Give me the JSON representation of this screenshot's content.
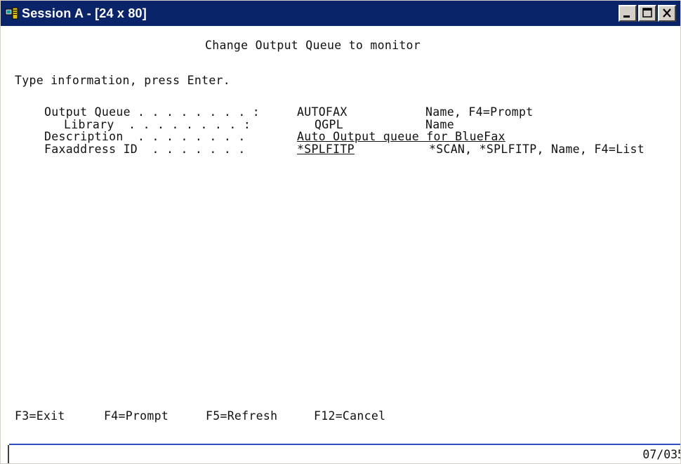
{
  "window": {
    "title": "Session A - [24 x 80]",
    "titlebar_color": "#0a246a"
  },
  "screen": {
    "heading": "Change Output Queue to monitor",
    "instruction": "Type information, press Enter.",
    "fields": [
      {
        "label": "Output Queue . . . . . . . . :",
        "value": "AUTOFAX",
        "hint": "Name, F4=Prompt"
      },
      {
        "label": "Library  . . . . . . . . :",
        "value": "QGPL",
        "hint": "Name"
      },
      {
        "label": "Description  . . . . . . . .",
        "value": "Auto Output queue for BlueFax"
      },
      {
        "label": "Faxaddress ID  . . . . . . .",
        "value": "*SPLFITP",
        "hint": "*SCAN, *SPLFITP, Name, F4=List"
      }
    ],
    "function_keys": {
      "f3": "F3=Exit",
      "f4": "F4=Prompt",
      "f5": "F5=Refresh",
      "f12": "F12=Cancel"
    },
    "status_position": "07/035"
  }
}
